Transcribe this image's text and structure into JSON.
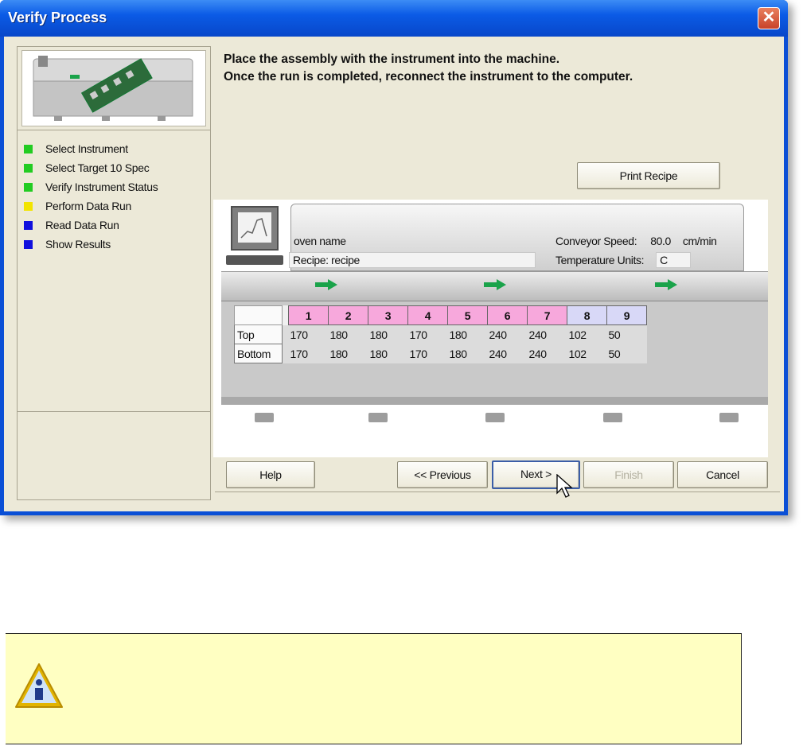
{
  "window": {
    "title": "Verify Process",
    "close_label": "✕"
  },
  "steps": [
    {
      "label": "Select Instrument",
      "color": "#22cc22"
    },
    {
      "label": "Select Target 10 Spec",
      "color": "#22cc22"
    },
    {
      "label": "Verify Instrument Status",
      "color": "#22cc22"
    },
    {
      "label": "Perform Data Run",
      "color": "#f2e400"
    },
    {
      "label": "Read Data Run",
      "color": "#1010dd"
    },
    {
      "label": "Show Results",
      "color": "#1010dd"
    }
  ],
  "instructions": {
    "line1": "Place the assembly with the instrument into the machine.",
    "line2": "Once the run is completed, reconnect the instrument to the computer."
  },
  "print_recipe_label": "Print Recipe",
  "oven": {
    "oven_name": "oven name",
    "recipe_label": "Recipe:",
    "recipe_value": "recipe",
    "conveyor_label": "Conveyor Speed:",
    "conveyor_value": "80.0",
    "conveyor_unit": "cm/min",
    "temp_units_label": "Temperature Units:",
    "temp_units_value": "C"
  },
  "zones": {
    "headers": [
      "1",
      "2",
      "3",
      "4",
      "5",
      "6",
      "7",
      "8",
      "9"
    ],
    "header_colors": [
      "#f7a8dc",
      "#f7a8dc",
      "#f7a8dc",
      "#f7a8dc",
      "#f7a8dc",
      "#f7a8dc",
      "#f7a8dc",
      "#d8d8f7",
      "#d8d8f7"
    ],
    "rows": [
      {
        "label": "Top",
        "values": [
          "170",
          "180",
          "180",
          "170",
          "180",
          "240",
          "240",
          "102",
          "50"
        ]
      },
      {
        "label": "Bottom",
        "values": [
          "170",
          "180",
          "180",
          "170",
          "180",
          "240",
          "240",
          "102",
          "50"
        ]
      }
    ]
  },
  "buttons": {
    "help": "Help",
    "previous": "<< Previous",
    "next": "Next >",
    "finish": "Finish",
    "cancel": "Cancel"
  }
}
